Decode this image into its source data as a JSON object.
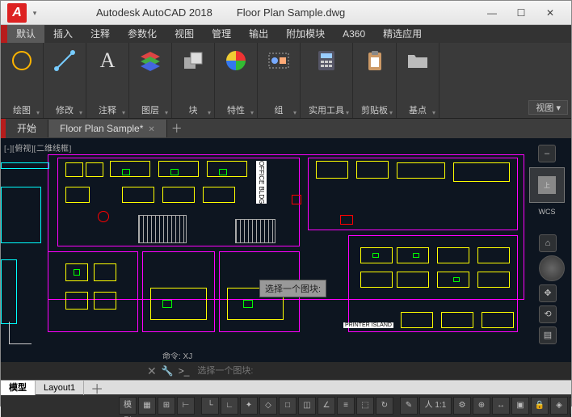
{
  "title": {
    "app": "Autodesk AutoCAD 2018",
    "file": "Floor Plan Sample.dwg"
  },
  "menu": {
    "items": [
      "默认",
      "插入",
      "注释",
      "参数化",
      "视图",
      "管理",
      "输出",
      "附加模块",
      "A360",
      "精选应用"
    ],
    "active": 0
  },
  "ribbon": {
    "panels": [
      {
        "label": "绘图",
        "icon": "circle"
      },
      {
        "label": "修改",
        "icon": "line-dots"
      },
      {
        "label": "注释",
        "icon": "text-a"
      },
      {
        "label": "图层",
        "icon": "layers"
      },
      {
        "label": "块",
        "icon": "block"
      },
      {
        "label": "特性",
        "icon": "palette"
      },
      {
        "label": "组",
        "icon": "group"
      },
      {
        "label": "实用工具",
        "icon": "calc"
      },
      {
        "label": "剪贴板",
        "icon": "clipboard"
      },
      {
        "label": "基点",
        "icon": "folder"
      }
    ],
    "context_tab": "视图 ▾"
  },
  "docs": {
    "tabs": [
      "开始",
      "Floor Plan Sample*"
    ],
    "active": 1
  },
  "viewport": {
    "label": "[-][俯视][二维线框]"
  },
  "canvas": {
    "labels": {
      "office": "OFFICE BLDG",
      "printer": "PRINTER ISLAND"
    }
  },
  "prompt": {
    "text": "选择一个图块:"
  },
  "nav": {
    "wcs": "WCS",
    "cube": "上"
  },
  "command": {
    "history": "命令: XJ",
    "prefix": ">_",
    "placeholder": "选择一个图块:"
  },
  "layouts": {
    "tabs": [
      "模型",
      "Layout1"
    ],
    "active": 0
  },
  "status": {
    "model": "模型",
    "icons": [
      "grid",
      "snap",
      "infer",
      "dyn",
      "ortho",
      "polar",
      "iso",
      "osnap",
      "3dosnap",
      "otrack",
      "lweight",
      "transp",
      "cycle",
      "ann",
      "scale",
      "ws",
      "monitor",
      "units",
      "quick",
      "lock",
      "iso2",
      "hw",
      "clean",
      "custom"
    ]
  }
}
